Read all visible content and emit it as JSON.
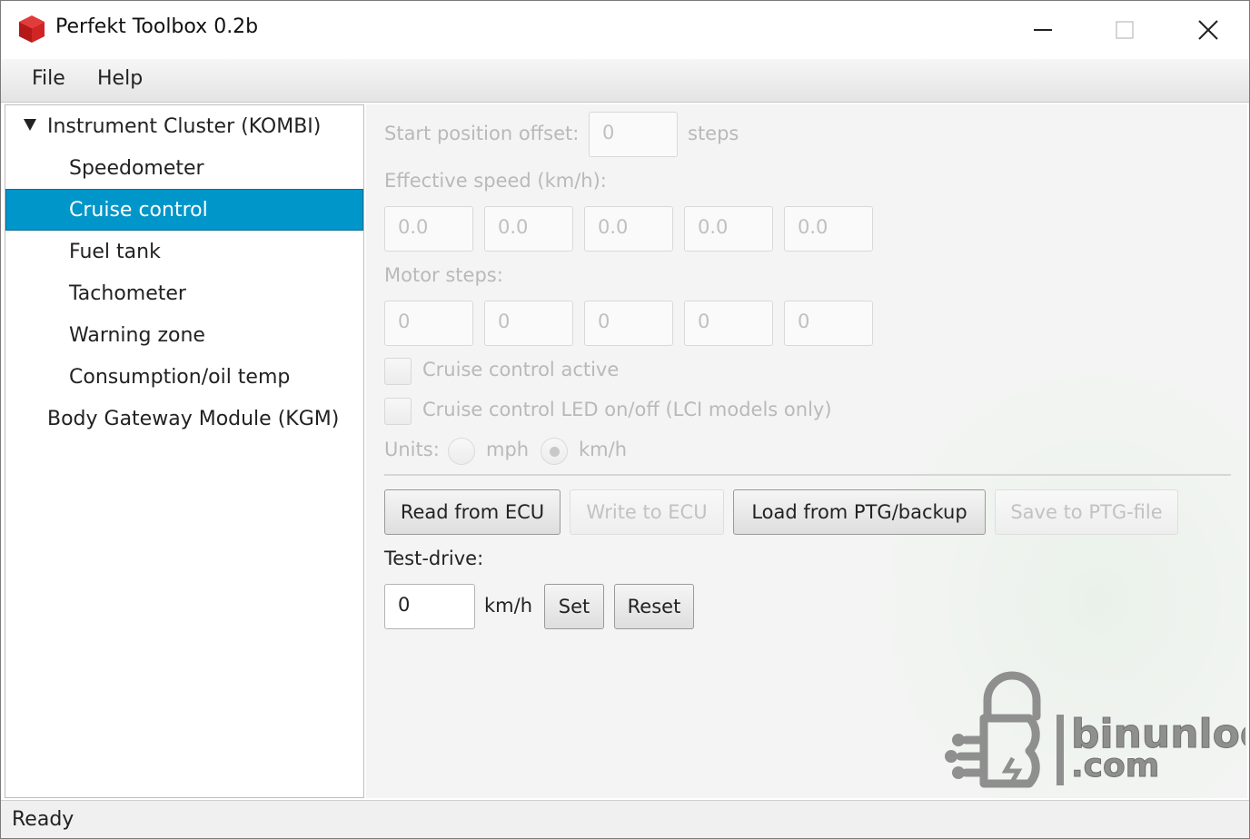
{
  "window": {
    "title": "Perfekt Toolbox 0.2b",
    "icon": "red-cube-icon",
    "controls": [
      "minimize-icon",
      "maximize-icon",
      "close-icon"
    ]
  },
  "menubar": {
    "items": [
      "File",
      "Help"
    ]
  },
  "tree": {
    "root": "Instrument Cluster (KOMBI)",
    "children": [
      "Speedometer",
      "Cruise control",
      "Fuel tank",
      "Tachometer",
      "Warning zone",
      "Consumption/oil temp"
    ],
    "selected": "Cruise control",
    "second_root": "Body Gateway Module (KGM)"
  },
  "form": {
    "start_offset_label": "Start position offset:",
    "start_offset_value": "0",
    "start_offset_unit": "steps",
    "effective_speed_label": "Effective speed (km/h):",
    "effective_speed_values": [
      "0.0",
      "0.0",
      "0.0",
      "0.0",
      "0.0"
    ],
    "motor_steps_label": "Motor steps:",
    "motor_steps_values": [
      "0",
      "0",
      "0",
      "0",
      "0"
    ],
    "cruise_active_label": "Cruise control active",
    "cruise_active_checked": false,
    "cruise_led_label": "Cruise control LED on/off (LCI models only)",
    "cruise_led_checked": false,
    "units_label": "Units:",
    "units_options": [
      "mph",
      "km/h"
    ],
    "units_selected": "km/h"
  },
  "actions": {
    "read_ecu": "Read from ECU",
    "write_ecu": "Write to ECU",
    "load_ptg": "Load from PTG/backup",
    "save_ptg": "Save to PTG-file"
  },
  "test_drive": {
    "label": "Test-drive:",
    "value": "0",
    "unit": "km/h",
    "set_label": "Set",
    "reset_label": "Reset"
  },
  "watermark": {
    "line1": "binunlock",
    "line2": ".com"
  },
  "status": {
    "text": "Ready"
  },
  "colors": {
    "selection": "#0096c9",
    "app_icon": "#cc1f1f",
    "watermark": "#8f8f8f"
  }
}
